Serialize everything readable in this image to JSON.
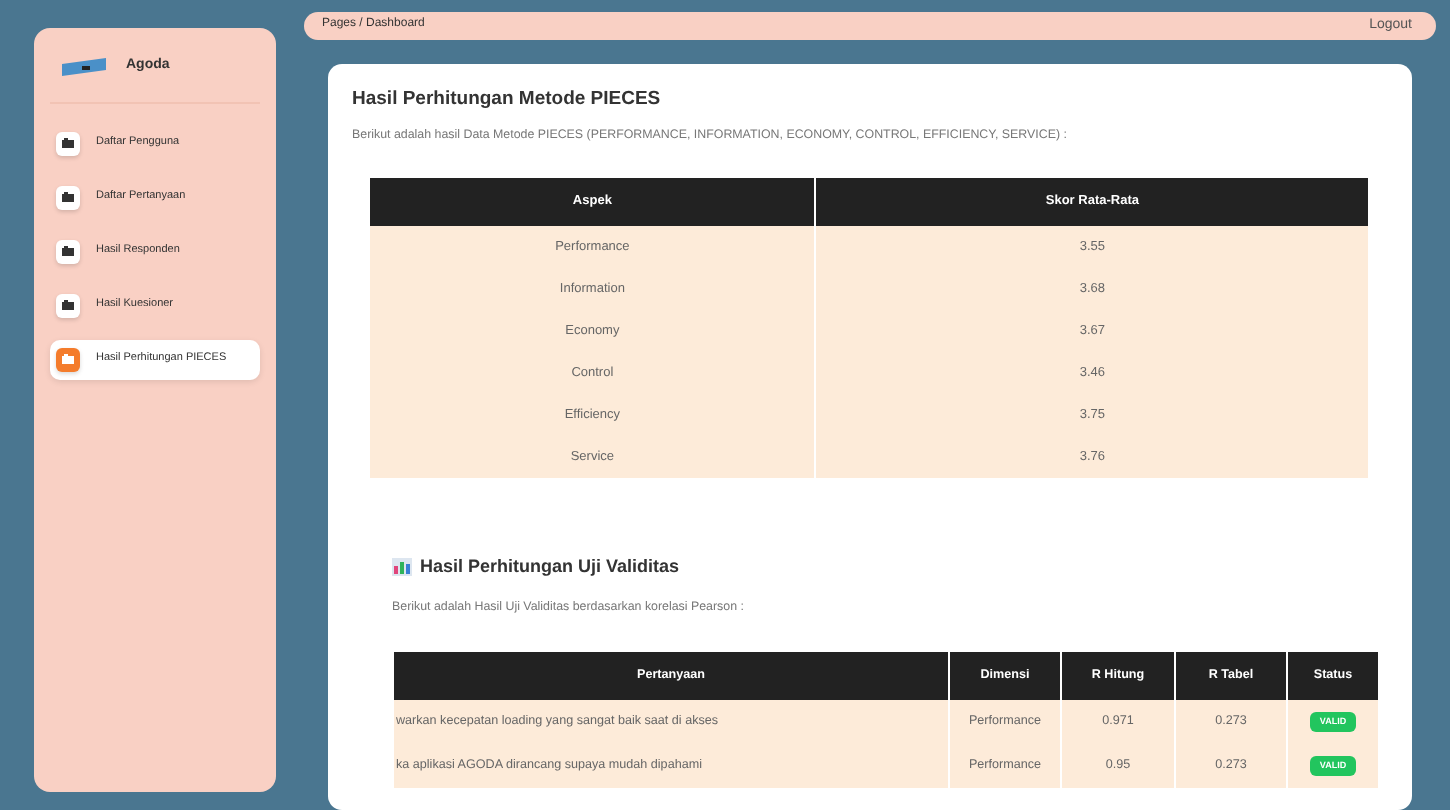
{
  "sidebar": {
    "brand": "Agoda",
    "items": [
      {
        "label": "Daftar Pengguna",
        "selected": false
      },
      {
        "label": "Daftar Pertanyaan",
        "selected": false
      },
      {
        "label": "Hasil Responden",
        "selected": false
      },
      {
        "label": "Hasil Kuesioner",
        "selected": false
      },
      {
        "label": "Hasil Perhitungan PIECES",
        "selected": true
      }
    ]
  },
  "topbar": {
    "breadcrumb": [
      "Pages",
      "Dashboard"
    ],
    "separator": "/",
    "logout": "Logout"
  },
  "pieces": {
    "title": "Hasil Perhitungan Metode PIECES",
    "subtitle": "Berikut adalah hasil Data Metode PIECES (PERFORMANCE, INFORMATION, ECONOMY, CONTROL, EFFICIENCY, SERVICE) :",
    "columns": [
      "Aspek",
      "Skor Rata-Rata"
    ],
    "rows": [
      [
        "Performance",
        "3.55"
      ],
      [
        "Information",
        "3.68"
      ],
      [
        "Economy",
        "3.67"
      ],
      [
        "Control",
        "3.46"
      ],
      [
        "Efficiency",
        "3.75"
      ],
      [
        "Service",
        "3.76"
      ]
    ]
  },
  "validity": {
    "title": "Hasil Perhitungan Uji Validitas",
    "subtitle": "Berikut adalah Hasil Uji Validitas berdasarkan korelasi Pearson :",
    "columns": [
      "Pertanyaan",
      "Dimensi",
      "R Hitung",
      "R Tabel",
      "Status"
    ],
    "rows": [
      {
        "question": "warkan kecepatan loading yang sangat baik saat di akses",
        "dimension": "Performance",
        "r_hitung": "0.971",
        "r_tabel": "0.273",
        "status": "VALID",
        "valid": true
      },
      {
        "question": "ka aplikasi AGODA dirancang supaya mudah dipahami",
        "dimension": "Performance",
        "r_hitung": "0.95",
        "r_tabel": "0.273",
        "status": "VALID",
        "valid": true
      }
    ]
  }
}
